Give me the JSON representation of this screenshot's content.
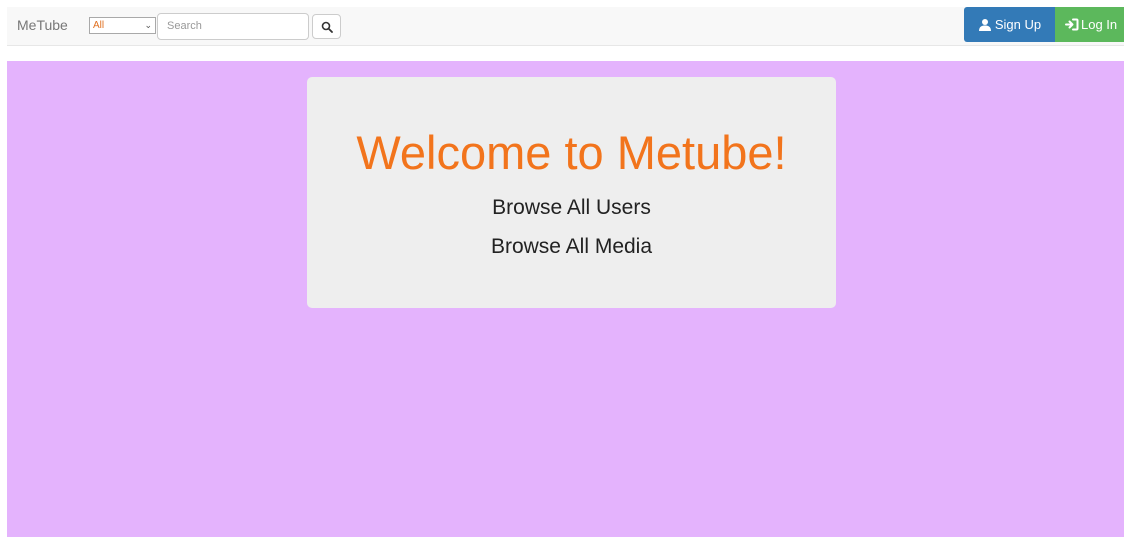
{
  "navbar": {
    "brand": "MeTube",
    "category": {
      "selected": "All"
    },
    "search": {
      "placeholder": "Search"
    },
    "signup_label": "Sign Up",
    "login_label": "Log In"
  },
  "main": {
    "title": "Welcome to Metube!",
    "links": {
      "users": "Browse All Users",
      "media": "Browse All Media"
    }
  },
  "colors": {
    "content_background": "#e4b3fd",
    "title_orange": "#f2741c",
    "signup_blue": "#337ab7",
    "login_green": "#5cb85c"
  },
  "icons": {
    "search": "magnifier-icon",
    "signup": "user-icon",
    "login": "login-arrow-icon"
  }
}
